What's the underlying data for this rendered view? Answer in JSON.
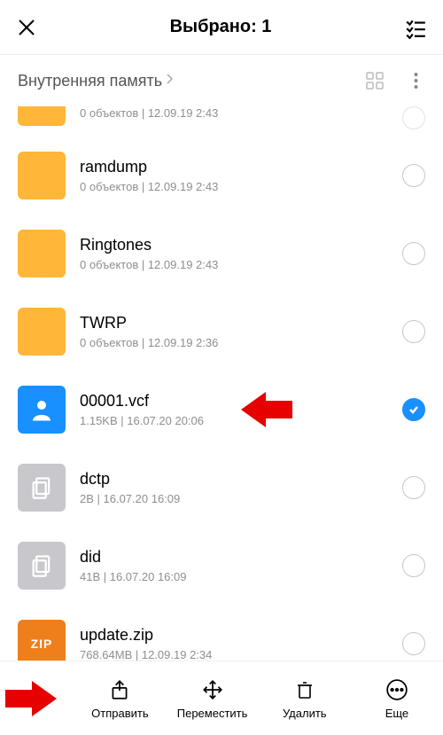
{
  "header": {
    "title": "Выбрано: 1"
  },
  "breadcrumb": {
    "label": "Внутренняя память"
  },
  "items": [
    {
      "name": "",
      "sub": "0 объектов | 12.09.19 2:43",
      "type": "folder",
      "selected": false,
      "partial": true
    },
    {
      "name": "ramdump",
      "sub": "0 объектов | 12.09.19 2:43",
      "type": "folder",
      "selected": false
    },
    {
      "name": "Ringtones",
      "sub": "0 объектов | 12.09.19 2:43",
      "type": "folder",
      "selected": false
    },
    {
      "name": "TWRP",
      "sub": "0 объектов | 12.09.19 2:36",
      "type": "folder",
      "selected": false
    },
    {
      "name": "00001.vcf",
      "sub": "1.15KB | 16.07.20 20:06",
      "type": "vcf",
      "selected": true
    },
    {
      "name": "dctp",
      "sub": "2B | 16.07.20 16:09",
      "type": "doc",
      "selected": false
    },
    {
      "name": "did",
      "sub": "41B | 16.07.20 16:09",
      "type": "doc",
      "selected": false
    },
    {
      "name": "update.zip",
      "sub": "768.64MB | 12.09.19 2:34",
      "type": "zip",
      "selected": false
    }
  ],
  "zip_badge": "ZIP",
  "toolbar": {
    "send": "Отправить",
    "move": "Переместить",
    "delete": "Удалить",
    "more": "Еще"
  }
}
